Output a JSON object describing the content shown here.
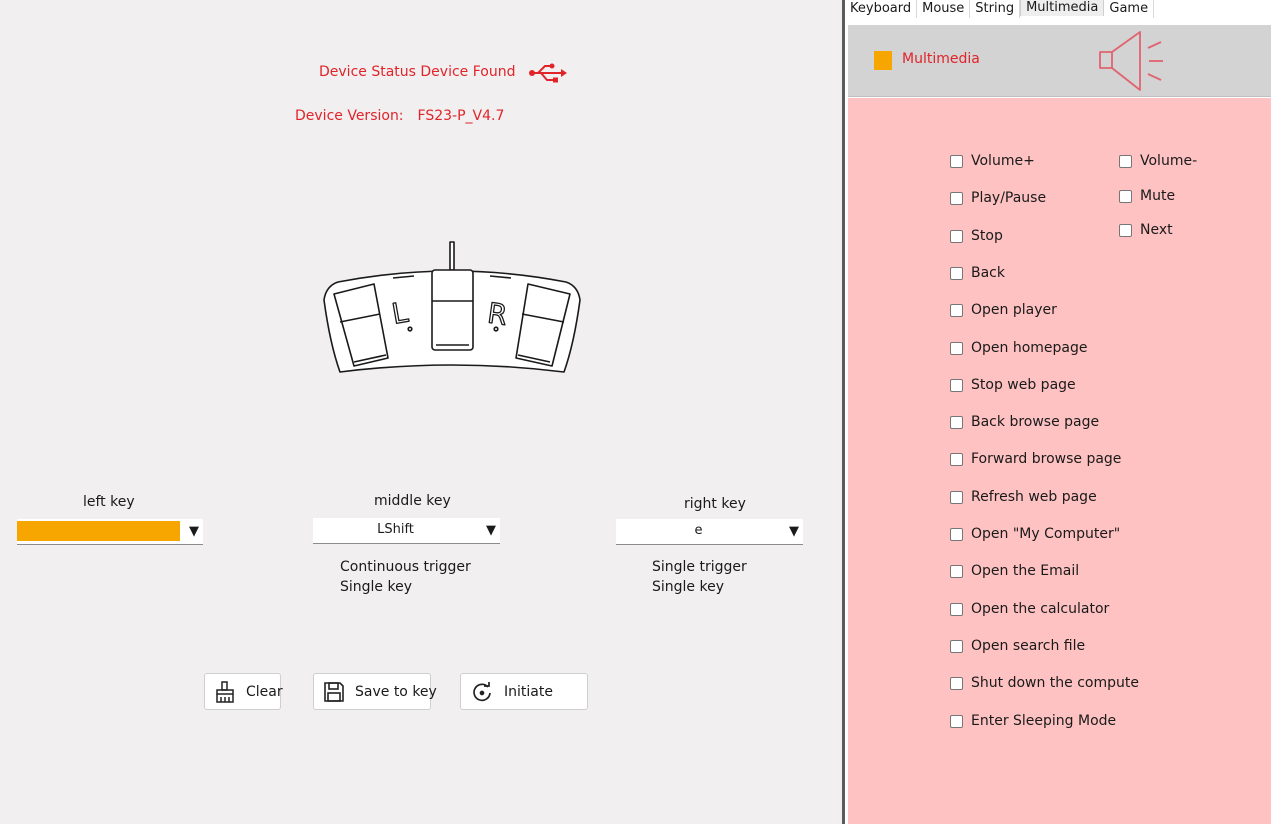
{
  "device": {
    "status_text": "Device Status Device Found",
    "version_label": "Device Version:",
    "version_value": "FS23-P_V4.7"
  },
  "keys": {
    "left": {
      "label": "left key",
      "value": "",
      "color": "#f7a600"
    },
    "middle": {
      "label": "middle key",
      "value": "LShift",
      "mode_line1": "Continuous trigger",
      "mode_line2": "Single key"
    },
    "right": {
      "label": "right key",
      "value": "e",
      "mode_line1": "Single trigger",
      "mode_line2": "Single key"
    }
  },
  "buttons": {
    "clear": "Clear",
    "save": "Save to key",
    "initiate": "Initiate"
  },
  "tabs": [
    "Keyboard",
    "Mouse",
    "String",
    "Multimedia",
    "Game"
  ],
  "active_tab": "Multimedia",
  "multimedia": {
    "title": "Multimedia",
    "accent": "#f7a600",
    "col1": [
      "Volume+",
      "Play/Pause",
      "Stop",
      "Back",
      "Open player",
      "Open homepage",
      "Stop web page",
      "Back browse page",
      "Forward browse page",
      "Refresh web page",
      "Open \"My Computer\"",
      "Open the Email",
      "Open the calculator",
      "Open search file",
      "Shut down the compute",
      "Enter Sleeping Mode"
    ],
    "col2": [
      "Volume-",
      "Mute",
      "Next"
    ]
  },
  "colors": {
    "status_red": "#e0242a",
    "panel_pink": "#ffc2c2",
    "header_gray": "#d3d3d3"
  }
}
